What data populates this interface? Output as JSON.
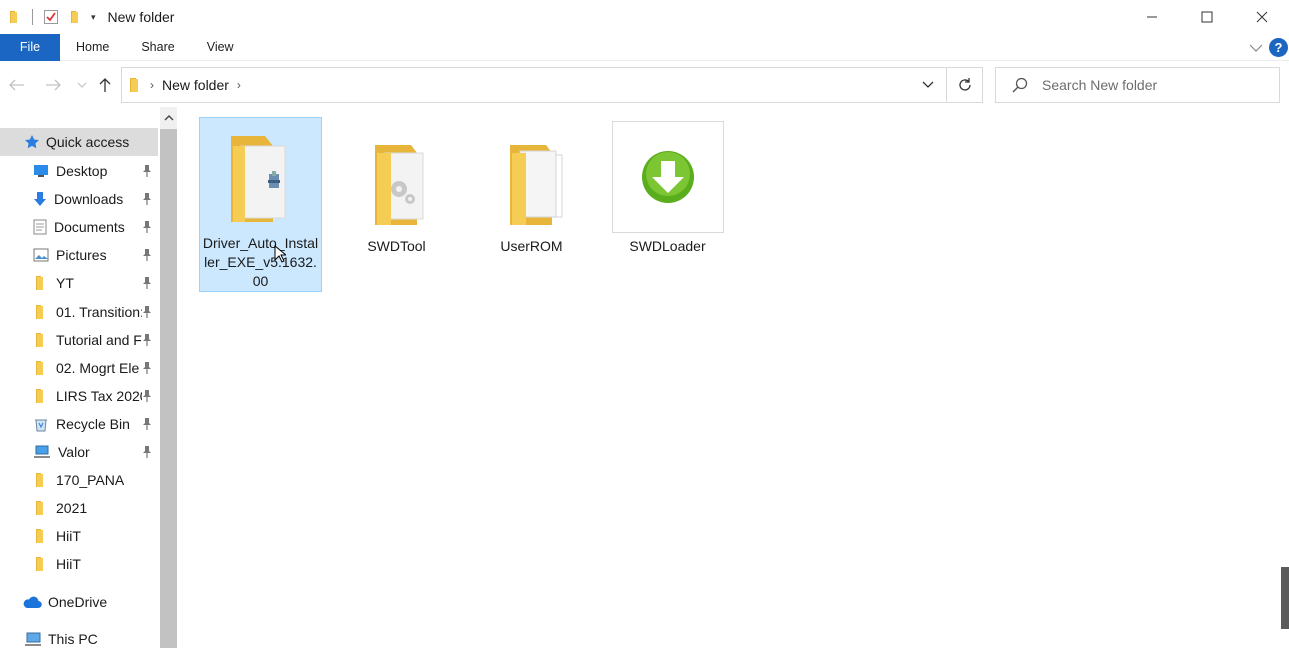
{
  "window": {
    "title": "New folder",
    "controls": [
      "minimize",
      "maximize",
      "close"
    ]
  },
  "ribbon": {
    "tabs": [
      {
        "label": "File"
      },
      {
        "label": "Home"
      },
      {
        "label": "Share"
      },
      {
        "label": "View"
      }
    ]
  },
  "navigation": {
    "address": {
      "crumbs": [
        "New folder"
      ]
    },
    "search": {
      "placeholder": "Search New folder"
    }
  },
  "sidebar": {
    "quick_access": {
      "label": "Quick access"
    },
    "items": [
      {
        "label": "Desktop",
        "icon": "desktop-icon",
        "pinned": true
      },
      {
        "label": "Downloads",
        "icon": "downloads-icon",
        "pinned": true
      },
      {
        "label": "Documents",
        "icon": "documents-icon",
        "pinned": true
      },
      {
        "label": "Pictures",
        "icon": "pictures-icon",
        "pinned": true
      },
      {
        "label": "YT",
        "icon": "folder-icon",
        "pinned": true
      },
      {
        "label": "01. Transition:",
        "icon": "folder-icon",
        "pinned": true
      },
      {
        "label": "Tutorial and F",
        "icon": "folder-icon",
        "pinned": true
      },
      {
        "label": "02. Mogrt Ele",
        "icon": "folder-icon",
        "pinned": true
      },
      {
        "label": "LIRS Tax 2020",
        "icon": "folder-icon",
        "pinned": true
      },
      {
        "label": "Recycle Bin",
        "icon": "recycle-bin-icon",
        "pinned": true
      },
      {
        "label": "Valor",
        "icon": "network-drive-icon",
        "pinned": true
      },
      {
        "label": "170_PANA",
        "icon": "folder-icon",
        "pinned": false
      },
      {
        "label": "2021",
        "icon": "folder-icon",
        "pinned": false
      },
      {
        "label": "HiiT",
        "icon": "folder-icon",
        "pinned": false
      },
      {
        "label": "HiiT",
        "icon": "folder-icon",
        "pinned": false
      }
    ],
    "onedrive": {
      "label": "OneDrive"
    },
    "thispc": {
      "label": "This PC"
    }
  },
  "files": [
    {
      "name": "Driver_Auto_Installer_EXE_v5.1632.00",
      "kind": "folder-with-installer",
      "selected": true
    },
    {
      "name": "SWDTool",
      "kind": "folder-with-gear",
      "selected": false
    },
    {
      "name": "UserROM",
      "kind": "folder-with-pages",
      "selected": false
    },
    {
      "name": "SWDLoader",
      "kind": "application-download",
      "selected": false
    }
  ],
  "colors": {
    "accent": "#1a66c2",
    "selection": "#cce8ff",
    "folder": "#f5c84c"
  }
}
